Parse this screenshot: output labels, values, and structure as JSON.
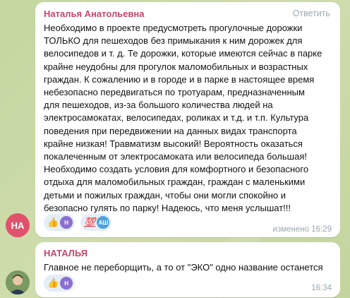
{
  "messages": [
    {
      "author": "Наталья Анатольевна",
      "avatar_initials": "НА",
      "avatar_color": "#e0526b",
      "author_color": "#c2476a",
      "reply_label": "Ответить",
      "text": "Необходимо в проекте предусмотреть прогулочные дорожки\nТОЛЬКО для пешеходов без примыкания к ним дорожек для\nвелосипедов и т. д. Те дорожки, которые имеются сейчас в парке\nкрайне неудобны для прогулок маломобильных  и возрастных\nграждан. К сожалению  и в городе и в парке  в настоящее время\nнебезопасно передвигаться по тротуарам, предназначенным\nдля пешеходов, из-за большого количества людей на\nэлектросамокатах, велосипедах, роликах и т.д. и т.п. Культура\nповедения при передвижении на данных видах транспорта\nкрайне низкая! Травматизм высокий! Вероятность оказаться\nпокалеченным от электросамоката или велосипеда большая!\nНеобходимо создать условия для комфортного и безопасного\nотдыха для маломобильных граждан, граждан с маленькими\nдетьми и пожилых граждан, чтобы они могли спокойно и\nбезопасно гулять по парку! Надеюсь, что меня услышат!!!",
      "reactions": [
        {
          "emoji": "👍",
          "avatar_initials": "Н",
          "avatar_color": "#8a6fd1"
        },
        {
          "emoji": "💯",
          "avatar_initials": "АШ",
          "avatar_color": "#4aa3dd"
        }
      ],
      "meta": "изменено 16:29"
    },
    {
      "author": "НАТАЛЬЯ",
      "author_color": "#c2476a",
      "text": "Главное не переборщить, а то от \"ЭКО\" одно название останется",
      "reactions": [
        {
          "emoji": "👍",
          "avatar_initials": "Н",
          "avatar_color": "#8a6fd1"
        }
      ],
      "meta": "16:34"
    }
  ]
}
